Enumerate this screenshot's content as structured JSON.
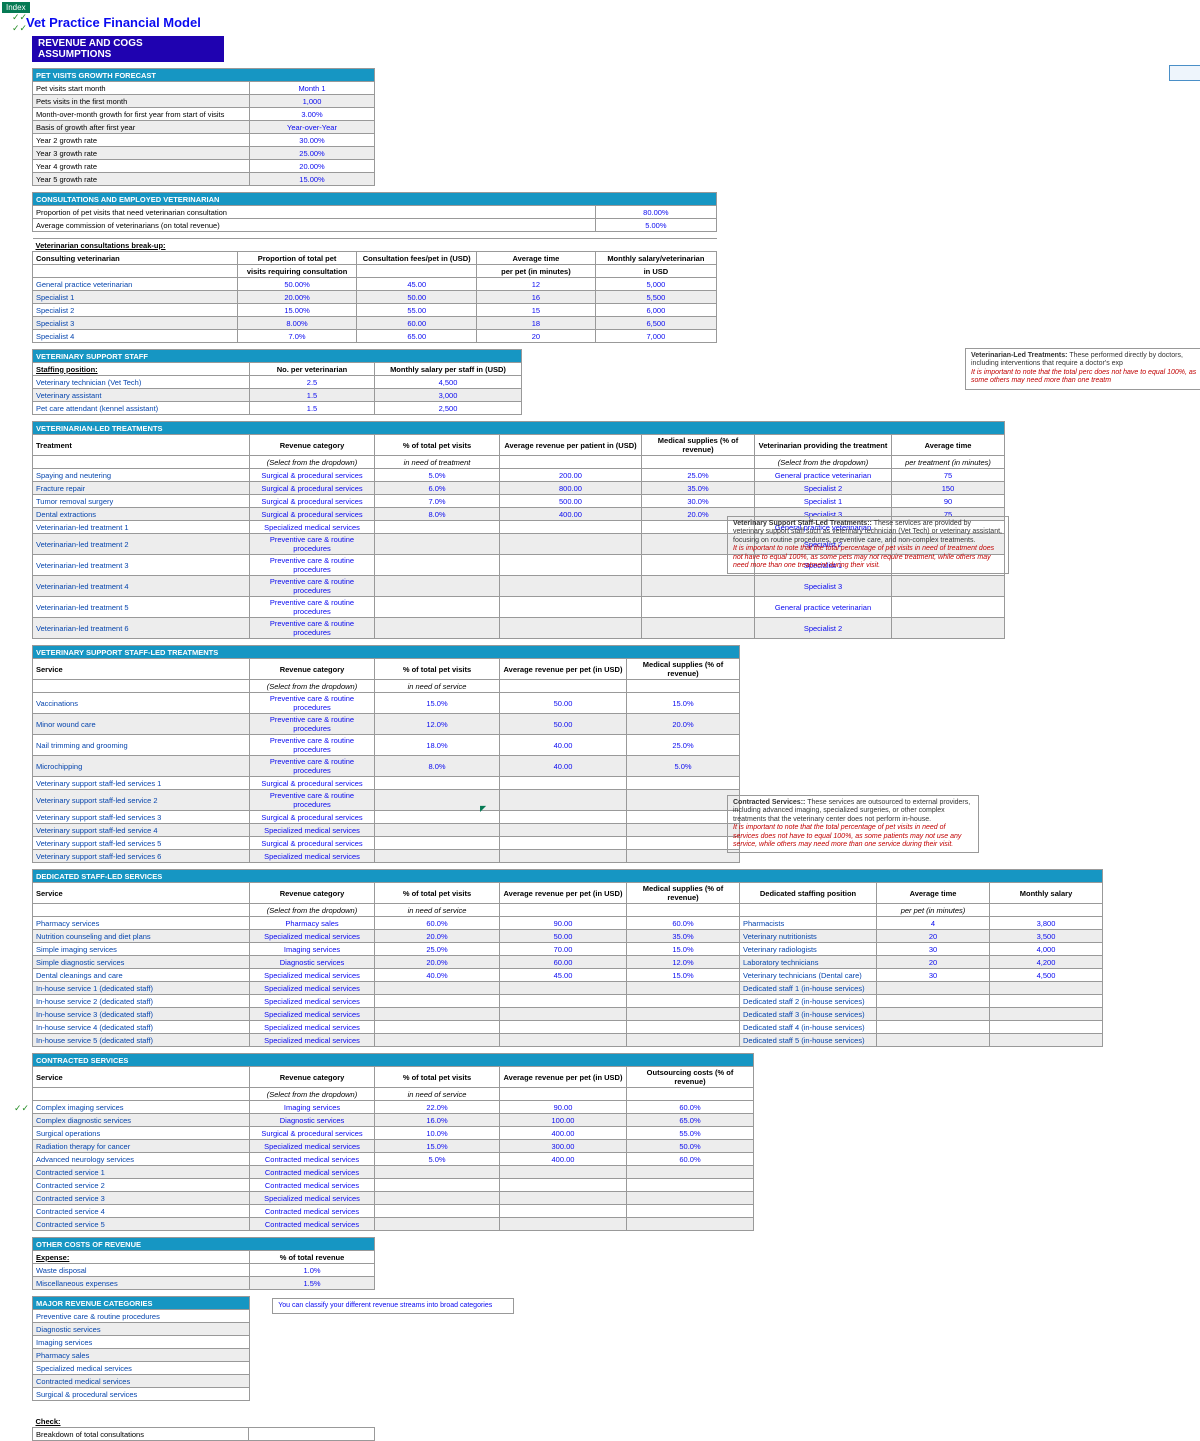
{
  "indexBtn": "Index",
  "title": "Vet Practice Financial Model",
  "sectionBar": "REVENUE AND COGS ASSUMPTIONS",
  "growth": {
    "hdr": "PET VISITS GROWTH FORECAST",
    "rows": [
      {
        "l": "Pet visits start month",
        "v": "Month 1"
      },
      {
        "l": "Pets visits in the first month",
        "v": "1,000"
      },
      {
        "l": "Month-over-month growth for first year from start of visits",
        "v": "3.00%"
      },
      {
        "l": "Basis of growth after first year",
        "v": "Year-over-Year"
      },
      {
        "l": "Year 2 growth rate",
        "v": "30.00%"
      },
      {
        "l": "Year 3 growth rate",
        "v": "25.00%"
      },
      {
        "l": "Year 4 growth rate",
        "v": "20.00%"
      },
      {
        "l": "Year 5 growth rate",
        "v": "15.00%"
      }
    ]
  },
  "consult": {
    "hdr": "CONSULTATIONS AND EMPLOYED VETERINARIAN",
    "r1": {
      "l": "Proportion of pet visits that need veterinarian consultation",
      "v": "80.00%"
    },
    "r2": {
      "l": "Average commission of veterinarians (on total revenue)",
      "v": "5.00%"
    },
    "sub": "Veterinarian consultations break-up:",
    "cols": [
      "Consulting veterinarian",
      "Proportion of total pet",
      "visits requiring consultation",
      "Consultation fees/pet  in (USD)",
      "Average time",
      "per pet (in minutes)",
      "Monthly salary/veterinarian",
      "in USD"
    ],
    "rows": [
      {
        "l": "General practice veterinarian",
        "p": "50.00%",
        "f": "45.00",
        "t": "12",
        "s": "5,000"
      },
      {
        "l": "Specialist 1",
        "p": "20.00%",
        "f": "50.00",
        "t": "16",
        "s": "5,500"
      },
      {
        "l": "Specialist 2",
        "p": "15.00%",
        "f": "55.00",
        "t": "15",
        "s": "6,000"
      },
      {
        "l": "Specialist 3",
        "p": "8.00%",
        "f": "60.00",
        "t": "18",
        "s": "6,500"
      },
      {
        "l": "Specialist 4",
        "p": "7.0%",
        "f": "65.00",
        "t": "20",
        "s": "7,000"
      }
    ]
  },
  "support": {
    "hdr": "VETERINARY SUPPORT STAFF",
    "cols": [
      "Staffing position:",
      "No. per veterinarian",
      "Monthly salary per staff in (USD)"
    ],
    "rows": [
      {
        "l": "Veterinary technician (Vet Tech)",
        "n": "2.5",
        "s": "4,500"
      },
      {
        "l": "Veterinary assistant",
        "n": "1.5",
        "s": "3,000"
      },
      {
        "l": "Pet care attendant (kennel assistant)",
        "n": "1.5",
        "s": "2,500"
      }
    ]
  },
  "vled": {
    "hdr": "VETERINARIAN-LED TREATMENTS",
    "cols": [
      "Treatment",
      "Revenue category",
      "% of total pet visits",
      "Average revenue per patient in (USD)",
      "Medical supplies (% of revenue)",
      "Veterinarian providing the treatment",
      "Average time"
    ],
    "sub": [
      "(Select from the dropdown)",
      "in need of treatment",
      "",
      "",
      "(Select from the dropdown)",
      "per treatment (in minutes)"
    ],
    "rows": [
      {
        "l": "Spaying and neutering",
        "c": "Surgical & procedural services",
        "p": "5.0%",
        "r": "200.00",
        "m": "25.0%",
        "v": "General practice veterinarian",
        "t": "75"
      },
      {
        "l": "Fracture repair",
        "c": "Surgical & procedural services",
        "p": "6.0%",
        "r": "800.00",
        "m": "35.0%",
        "v": "Specialist 2",
        "t": "150"
      },
      {
        "l": "Tumor removal surgery",
        "c": "Surgical & procedural services",
        "p": "7.0%",
        "r": "500.00",
        "m": "30.0%",
        "v": "Specialist 1",
        "t": "90"
      },
      {
        "l": "Dental extractions",
        "c": "Surgical & procedural services",
        "p": "8.0%",
        "r": "400.00",
        "m": "20.0%",
        "v": "Specialist 3",
        "t": "75"
      },
      {
        "l": "Veterinarian-led treatment 1",
        "c": "Specialized medical services",
        "p": "",
        "r": "",
        "m": "",
        "v": "General practice veterinarian",
        "t": ""
      },
      {
        "l": "Veterinarian-led treatment 2",
        "c": "Preventive care & routine procedures",
        "p": "",
        "r": "",
        "m": "",
        "v": "Specialist 2",
        "t": ""
      },
      {
        "l": "Veterinarian-led treatment 3",
        "c": "Preventive care & routine procedures",
        "p": "",
        "r": "",
        "m": "",
        "v": "Specialist 1",
        "t": ""
      },
      {
        "l": "Veterinarian-led treatment 4",
        "c": "Preventive care & routine procedures",
        "p": "",
        "r": "",
        "m": "",
        "v": "Specialist 3",
        "t": ""
      },
      {
        "l": "Veterinarian-led treatment 5",
        "c": "Preventive care & routine procedures",
        "p": "",
        "r": "",
        "m": "",
        "v": "General practice veterinarian",
        "t": ""
      },
      {
        "l": "Veterinarian-led treatment 6",
        "c": "Preventive care & routine procedures",
        "p": "",
        "r": "",
        "m": "",
        "v": "Specialist 2",
        "t": ""
      }
    ]
  },
  "sled": {
    "hdr": "VETERINARY SUPPORT STAFF-LED TREATMENTS",
    "cols": [
      "Service",
      "Revenue category",
      "% of total pet visits",
      "Average revenue per pet (in USD)",
      "Medical supplies (% of revenue)"
    ],
    "sub": [
      "(Select from the dropdown)",
      "in need of service",
      "",
      ""
    ],
    "rows": [
      {
        "l": "Vaccinations",
        "c": "Preventive care & routine procedures",
        "p": "15.0%",
        "r": "50.00",
        "m": "15.0%"
      },
      {
        "l": "Minor wound care",
        "c": "Preventive care & routine procedures",
        "p": "12.0%",
        "r": "50.00",
        "m": "20.0%"
      },
      {
        "l": "Nail trimming and grooming",
        "c": "Preventive care & routine procedures",
        "p": "18.0%",
        "r": "40.00",
        "m": "25.0%"
      },
      {
        "l": "Microchipping",
        "c": "Preventive care & routine procedures",
        "p": "8.0%",
        "r": "40.00",
        "m": "5.0%"
      },
      {
        "l": "Veterinary support staff-led services 1",
        "c": "Surgical & procedural services",
        "p": "",
        "r": "",
        "m": ""
      },
      {
        "l": "Veterinary support staff-led service 2",
        "c": "Preventive care & routine procedures",
        "p": "",
        "r": "",
        "m": ""
      },
      {
        "l": "Veterinary support staff-led services 3",
        "c": "Surgical & procedural services",
        "p": "",
        "r": "",
        "m": ""
      },
      {
        "l": "Veterinary support staff-led service 4",
        "c": "Specialized medical services",
        "p": "",
        "r": "",
        "m": ""
      },
      {
        "l": "Veterinary support staff-led services 5",
        "c": "Surgical & procedural services",
        "p": "",
        "r": "",
        "m": ""
      },
      {
        "l": "Veterinary support staff-led services 6",
        "c": "Specialized medical services",
        "p": "",
        "r": "",
        "m": ""
      }
    ]
  },
  "ded": {
    "hdr": "DEDICATED STAFF-LED SERVICES",
    "cols": [
      "Service",
      "Revenue category",
      "% of total pet visits",
      "Average revenue per pet (in USD)",
      "Medical supplies (% of revenue)",
      "Dedicated staffing position",
      "Average time",
      "Monthly salary"
    ],
    "sub": [
      "(Select from the dropdown)",
      "in need of service",
      "",
      "",
      "",
      "per pet (in minutes)",
      ""
    ],
    "rows": [
      {
        "l": "Pharmacy services",
        "c": "Pharmacy sales",
        "p": "60.0%",
        "r": "90.00",
        "m": "60.0%",
        "d": "Pharmacists",
        "t": "4",
        "s": "3,800"
      },
      {
        "l": "Nutrition counseling and diet plans",
        "c": "Specialized medical services",
        "p": "20.0%",
        "r": "50.00",
        "m": "35.0%",
        "d": "Veterinary nutritionists",
        "t": "20",
        "s": "3,500"
      },
      {
        "l": "Simple imaging services",
        "c": "Imaging services",
        "p": "25.0%",
        "r": "70.00",
        "m": "15.0%",
        "d": "Veterinary radiologists",
        "t": "30",
        "s": "4,000"
      },
      {
        "l": "Simple diagnostic services",
        "c": "Diagnostic services",
        "p": "20.0%",
        "r": "60.00",
        "m": "12.0%",
        "d": "Laboratory technicians",
        "t": "20",
        "s": "4,200"
      },
      {
        "l": "Dental cleanings and care",
        "c": "Specialized medical services",
        "p": "40.0%",
        "r": "45.00",
        "m": "15.0%",
        "d": "Veterinary technicians (Dental care)",
        "t": "30",
        "s": "4,500"
      },
      {
        "l": "In-house service 1 (dedicated staff)",
        "c": "Specialized medical services",
        "p": "",
        "r": "",
        "m": "",
        "d": "Dedicated staff 1 (in-house services)",
        "t": "",
        "s": ""
      },
      {
        "l": "In-house service 2 (dedicated staff)",
        "c": "Specialized medical services",
        "p": "",
        "r": "",
        "m": "",
        "d": "Dedicated staff 2 (in-house services)",
        "t": "",
        "s": ""
      },
      {
        "l": "In-house service 3 (dedicated staff)",
        "c": "Specialized medical services",
        "p": "",
        "r": "",
        "m": "",
        "d": "Dedicated staff 3 (in-house services)",
        "t": "",
        "s": ""
      },
      {
        "l": "In-house service 4 (dedicated staff)",
        "c": "Specialized medical services",
        "p": "",
        "r": "",
        "m": "",
        "d": "Dedicated staff 4 (in-house services)",
        "t": "",
        "s": ""
      },
      {
        "l": "In-house service 5 (dedicated staff)",
        "c": "Specialized medical services",
        "p": "",
        "r": "",
        "m": "",
        "d": "Dedicated staff 5 (in-house services)",
        "t": "",
        "s": ""
      }
    ]
  },
  "con": {
    "hdr": "CONTRACTED SERVICES",
    "cols": [
      "Service",
      "Revenue category",
      "% of total pet visits",
      "Average revenue per pet (in USD)",
      "Outsourcing costs (% of revenue)"
    ],
    "sub": [
      "(Select from the dropdown)",
      "in need of service",
      "",
      ""
    ],
    "rows": [
      {
        "l": "Complex imaging services",
        "c": "Imaging services",
        "p": "22.0%",
        "r": "90.00",
        "m": "60.0%"
      },
      {
        "l": "Complex diagnostic services",
        "c": "Diagnostic services",
        "p": "16.0%",
        "r": "100.00",
        "m": "65.0%"
      },
      {
        "l": "Surgical operations",
        "c": "Surgical & procedural services",
        "p": "10.0%",
        "r": "400.00",
        "m": "55.0%"
      },
      {
        "l": "Radiation therapy for cancer",
        "c": "Specialized medical services",
        "p": "15.0%",
        "r": "300.00",
        "m": "50.0%"
      },
      {
        "l": "Advanced neurology services",
        "c": "Contracted medical services",
        "p": "5.0%",
        "r": "400.00",
        "m": "60.0%"
      },
      {
        "l": "Contracted service 1",
        "c": "Contracted medical services",
        "p": "",
        "r": "",
        "m": ""
      },
      {
        "l": "Contracted service 2",
        "c": "Contracted medical services",
        "p": "",
        "r": "",
        "m": ""
      },
      {
        "l": "Contracted service 3",
        "c": "Specialized medical services",
        "p": "",
        "r": "",
        "m": ""
      },
      {
        "l": "Contracted service 4",
        "c": "Contracted medical services",
        "p": "",
        "r": "",
        "m": ""
      },
      {
        "l": "Contracted service 5",
        "c": "Contracted medical services",
        "p": "",
        "r": "",
        "m": ""
      }
    ]
  },
  "other": {
    "hdr": "OTHER COSTS OF REVENUE",
    "cols": [
      "Expense:",
      "% of total revenue"
    ],
    "rows": [
      {
        "l": "Waste disposal",
        "v": "1.0%"
      },
      {
        "l": "Miscellaneous expenses",
        "v": "1.5%"
      }
    ]
  },
  "major": {
    "hdr": "MAJOR REVENUE CATEGORIES",
    "rows": [
      "Preventive care & routine procedures",
      "Diagnostic services",
      "Imaging services",
      "Pharmacy sales",
      "Specialized medical services",
      "Contracted medical services",
      "Surgical & procedural services"
    ],
    "note": "You can classify your different revenue streams into broad categories"
  },
  "check": {
    "h": "Check:",
    "l": "Breakdown of total consultations"
  },
  "notes": {
    "vled": {
      "t": "Veterinarian-Led Treatments:",
      "b": "These performed directly by doctors, including interventions that require a doctor's exp",
      "r": "It is  important to note that the total perc does not have to equal 100%, as some others may need more than one treatm"
    },
    "sled": {
      "t": "Veterinary Support Staff-Led Treatments::",
      "b": "These services are provided by veterinary support staff such as veterinary technician (Vet Tech) or veterinary assistant, focusing on routine procedures, preventive care, and non-complex treatments.",
      "r": "It is  important to note that the total percentage of pet visits in need of treatment does not have to equal 100%, as some pets may not require treatment, while others may need more than one treatment during their visit."
    },
    "con": {
      "t": "Contracted Services::",
      "b": "These services are outsourced to external providers, including advanced imaging, specialized surgeries, or other complex treatments that the veterinary center does not perform in-house.",
      "r": "It is  important to note that the total percentage of pet visits in need of services does not have to equal 100%, as some patients may not use any service, while others may need more than one service during their visit."
    }
  }
}
